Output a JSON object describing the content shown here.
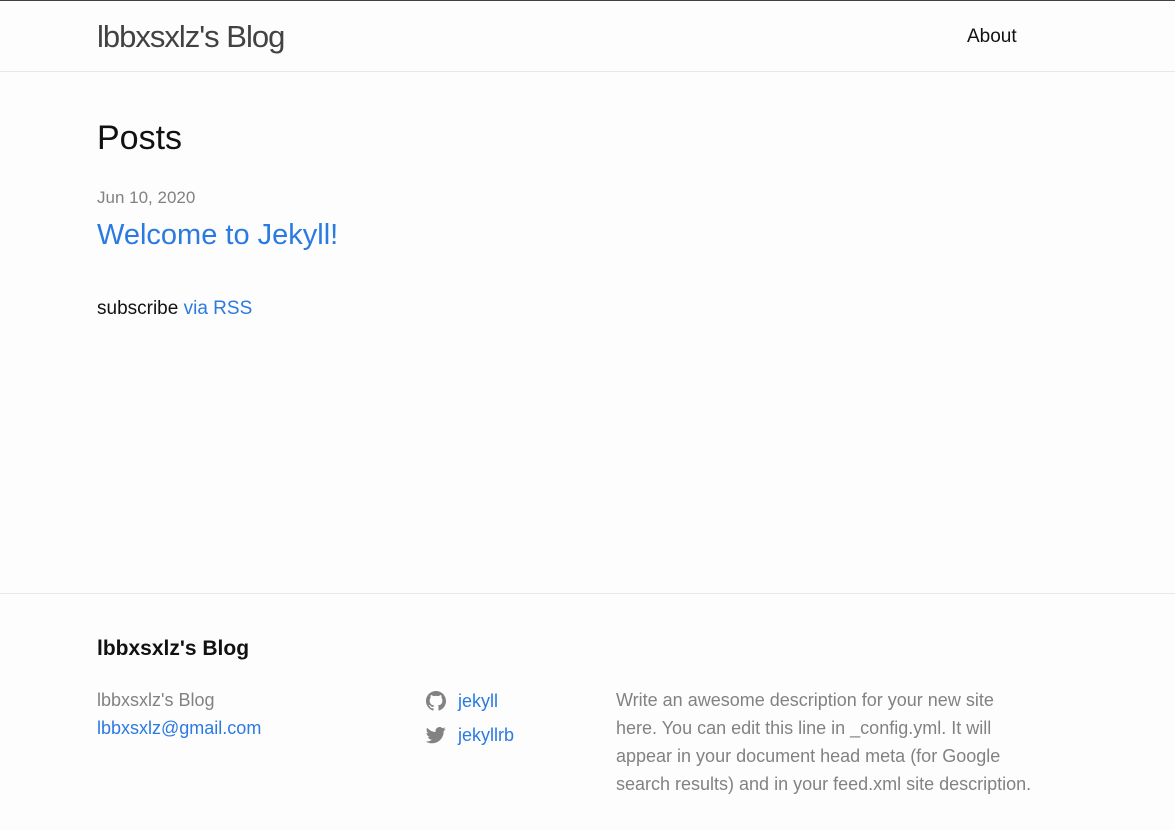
{
  "header": {
    "site_title": "lbbxsxlz's Blog",
    "nav": [
      {
        "label": "About"
      }
    ]
  },
  "main": {
    "heading": "Posts",
    "posts": [
      {
        "date": "Jun 10, 2020",
        "title": "Welcome to Jekyll!"
      }
    ],
    "rss": {
      "prefix": "subscribe",
      "link_label": "via RSS"
    }
  },
  "footer": {
    "heading": "lbbxsxlz's Blog",
    "name": "lbbxsxlz's Blog",
    "email": "lbbxsxlz@gmail.com",
    "social": [
      {
        "icon": "github-icon",
        "label": "jekyll"
      },
      {
        "icon": "twitter-icon",
        "label": "jekyllrb"
      }
    ],
    "description": "Write an awesome description for your new site here. You can edit this line in _config.yml. It will appear in your document head meta (for Google search results) and in your feed.xml site description."
  },
  "colors": {
    "link": "#2a7ae2",
    "muted": "#828282",
    "text": "#111111",
    "border": "#e8e8e8"
  }
}
